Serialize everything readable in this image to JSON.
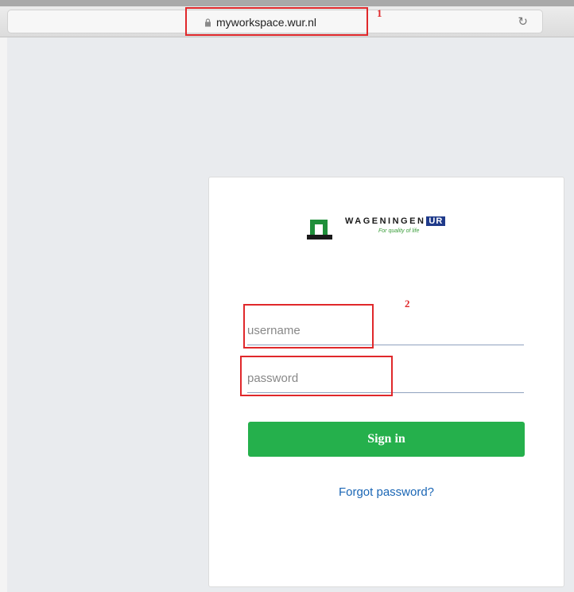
{
  "browser": {
    "url": "myworkspace.wur.nl",
    "reload_icon": "↻",
    "lock_icon": "lock-icon"
  },
  "annotations": [
    {
      "number": "1"
    },
    {
      "number": "2"
    }
  ],
  "login": {
    "logo_name": "WAGENINGEN",
    "logo_suffix": "UR",
    "logo_tagline": "For quality of life",
    "username_placeholder": "username",
    "password_placeholder": "password",
    "signin_label": "Sign in",
    "forgot_label": "Forgot password?"
  },
  "colors": {
    "accent_green": "#25b04c",
    "link_blue": "#1a66b5",
    "annotation_red": "#e0282b",
    "logo_blue": "#1f3a8a"
  }
}
